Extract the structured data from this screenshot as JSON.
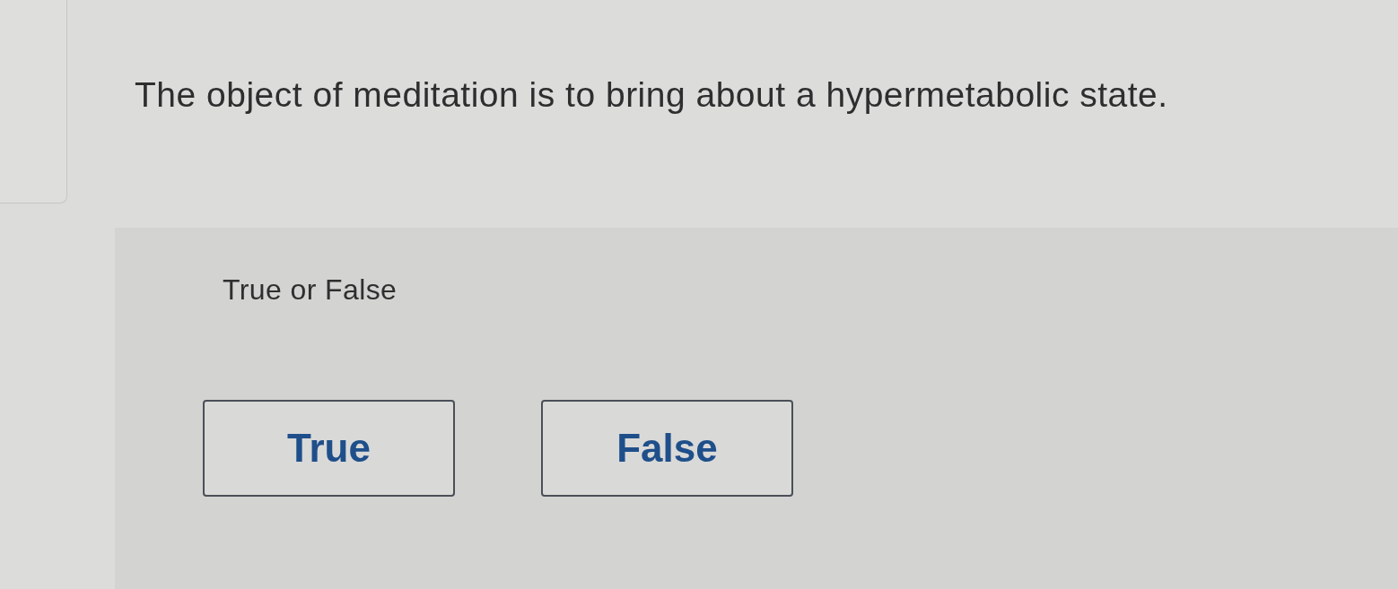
{
  "question": {
    "prompt": "The object of meditation is to bring about a hypermetabolic state."
  },
  "answer_panel": {
    "instruction": "True or False",
    "options": [
      {
        "label": "True",
        "selected": false
      },
      {
        "label": "False",
        "selected": false
      }
    ]
  }
}
